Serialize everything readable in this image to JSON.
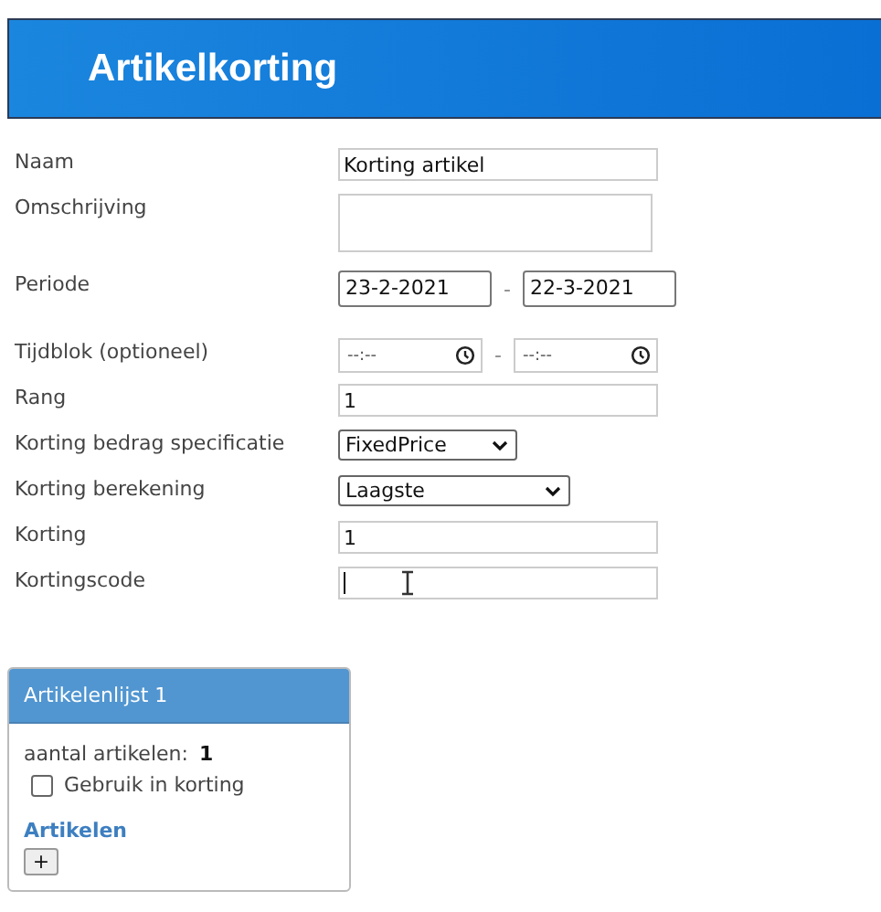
{
  "header": {
    "title": "Artikelkorting"
  },
  "fields": [
    {
      "kind": "text",
      "label": "Naam",
      "value": "Korting artikel"
    },
    {
      "kind": "textarea",
      "label": "Omschrijving"
    },
    {
      "kind": "daterange",
      "label": "Periode",
      "from": "23-2-2021",
      "separator": "-",
      "to": "22-3-2021"
    },
    {
      "kind": "timerange",
      "label": "Tijdblok (optioneel)",
      "from": "--:--",
      "separator": "-",
      "to": "--:--"
    },
    {
      "kind": "text",
      "label": "Rang",
      "value": "1"
    },
    {
      "kind": "select",
      "label": "Korting bedrag specificatie",
      "value": "FixedPrice"
    },
    {
      "kind": "wideselect",
      "label": "Korting berekening",
      "value": "Laagste"
    },
    {
      "kind": "text",
      "label": "Korting",
      "value": "1"
    },
    {
      "kind": "text",
      "label": "Kortingscode",
      "focused": true
    }
  ],
  "panel": {
    "title": "Artikelenlijst 1",
    "count_label": "aantal artikelen:",
    "count": "1",
    "checkbox": {
      "label": "Gebruik in korting",
      "checked": false
    },
    "section": "Artikelen",
    "add_button": "+"
  }
}
